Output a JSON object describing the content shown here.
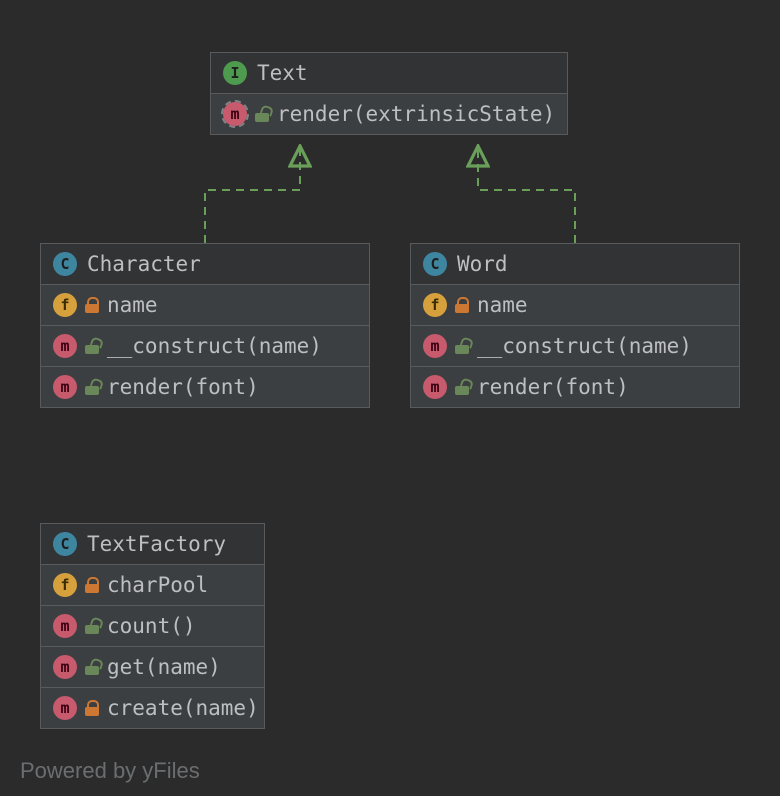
{
  "watermark": "Powered by yFiles",
  "classes": {
    "text": {
      "kind": "I",
      "name": "Text",
      "members": [
        {
          "badge": "m",
          "abstract": true,
          "vis": "green-open",
          "sig": "render(extrinsicState)"
        }
      ]
    },
    "character": {
      "kind": "C",
      "name": "Character",
      "members": [
        {
          "badge": "f",
          "vis": "orange-closed",
          "sig": "name"
        },
        {
          "badge": "m",
          "vis": "green-open",
          "sig": "__construct(name)"
        },
        {
          "badge": "m",
          "vis": "green-open",
          "sig": "render(font)"
        }
      ]
    },
    "word": {
      "kind": "C",
      "name": "Word",
      "members": [
        {
          "badge": "f",
          "vis": "orange-closed",
          "sig": "name"
        },
        {
          "badge": "m",
          "vis": "green-open",
          "sig": "__construct(name)"
        },
        {
          "badge": "m",
          "vis": "green-open",
          "sig": "render(font)"
        }
      ]
    },
    "textfactory": {
      "kind": "C",
      "name": "TextFactory",
      "members": [
        {
          "badge": "f",
          "vis": "orange-closed",
          "sig": "charPool"
        },
        {
          "badge": "m",
          "vis": "green-open",
          "sig": "count()"
        },
        {
          "badge": "m",
          "vis": "green-open",
          "sig": "get(name)"
        },
        {
          "badge": "m",
          "vis": "orange-closed",
          "sig": "create(name)"
        }
      ]
    }
  },
  "relations": [
    {
      "from": "character",
      "to": "text",
      "type": "realization"
    },
    {
      "from": "word",
      "to": "text",
      "type": "realization"
    }
  ]
}
